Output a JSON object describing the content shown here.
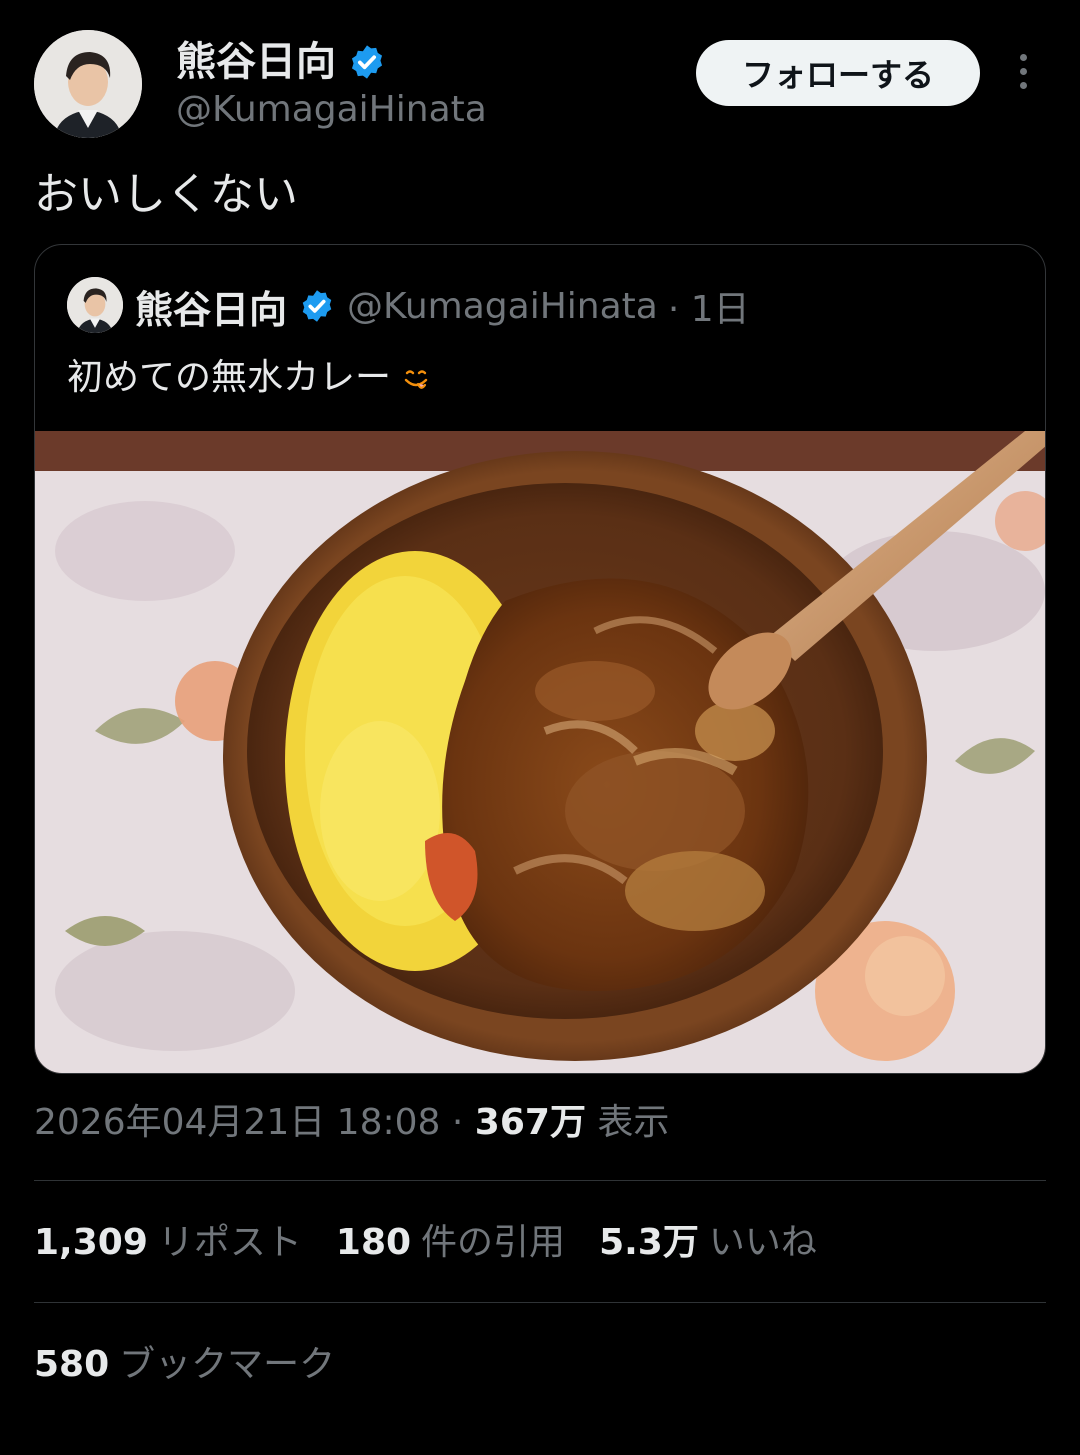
{
  "author": {
    "name": "熊谷日向",
    "handle": "@KumagaiHinata",
    "verified": true
  },
  "follow_button": "フォローする",
  "tweet_text": "おいしくない",
  "quoted_tweet": {
    "name": "熊谷日向",
    "handle": "@KumagaiHinata",
    "time": "· 1日",
    "text": "初めての無水カレー",
    "emoji": "face-savoring-food-icon",
    "image": "curry rice in wooden bowl with wooden spoon"
  },
  "meta": {
    "timestamp": "2026年04月21日 18:08",
    "separator": "·",
    "views": "367万",
    "views_label": "表示"
  },
  "stats": [
    {
      "value": "1,309",
      "label": "リポスト"
    },
    {
      "value": "180",
      "label": "件の引用"
    },
    {
      "value": "5.3万",
      "label": "いいね"
    }
  ],
  "bookmarks": {
    "value": "580",
    "label": "ブックマーク"
  },
  "colors": {
    "background": "#000000",
    "text": "#e7e9ea",
    "secondary_text": "#71767b",
    "verified": "#1d9bf0",
    "border": "#2f3336"
  }
}
